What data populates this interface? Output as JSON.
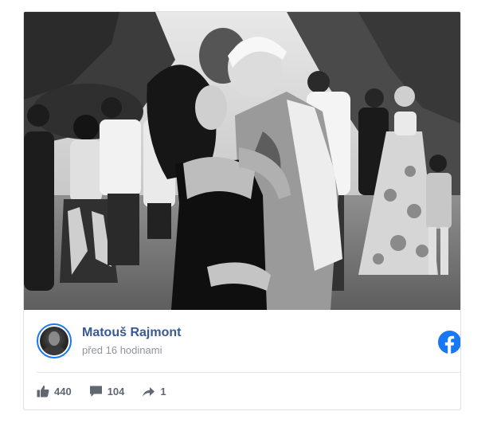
{
  "post": {
    "author_name": "Matouš Rajmont",
    "timestamp": "před 16 hodinami",
    "likes": "440",
    "comments": "104",
    "shares": "1"
  },
  "icons": {
    "platform": "facebook-icon",
    "like": "thumbs-up-icon",
    "comment": "comment-bubble-icon",
    "share": "share-arrow-icon"
  },
  "colors": {
    "brand": "#1877f2",
    "author_link": "#385898",
    "muted": "#90949c",
    "stat_text": "#606770"
  }
}
